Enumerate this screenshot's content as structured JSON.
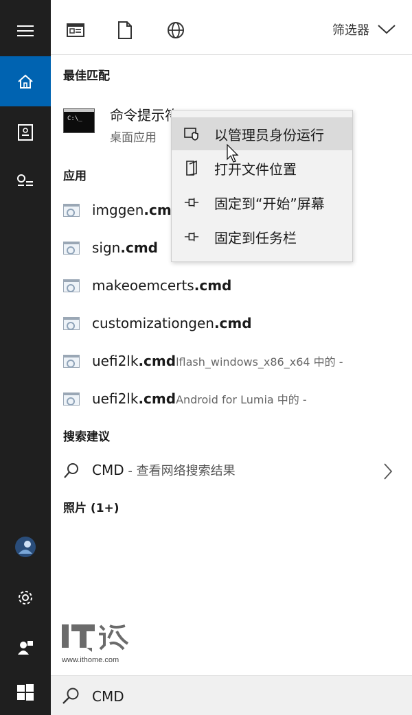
{
  "rail": {
    "items": [
      "hamburger-menu",
      "home",
      "documents",
      "settings-list",
      "user-avatar",
      "settings-gear",
      "feedback-user",
      "windows-start"
    ]
  },
  "toolbar": {
    "icons": [
      "apps-icon",
      "document-icon",
      "globe-icon"
    ],
    "filter_label": "筛选器"
  },
  "sections": {
    "best_match": "最佳匹配",
    "apps": "应用",
    "suggestions": "搜索建议",
    "photos": "照片 (1+)"
  },
  "best_match": {
    "title": "命令提示符",
    "subtitle": "桌面应用",
    "icon_text": "C:\\_"
  },
  "apps": [
    {
      "prefix": "imggen",
      "bold": ".cmd",
      "loc": ""
    },
    {
      "prefix": "sign",
      "bold": ".cmd",
      "loc": ""
    },
    {
      "prefix": "makeoemcerts",
      "bold": ".cmd",
      "loc": ""
    },
    {
      "prefix": "customizationgen",
      "bold": ".cmd",
      "loc": ""
    },
    {
      "prefix": "uefi2lk",
      "bold": ".cmd",
      "loc": "lflash_windows_x86_x64 中的 -"
    },
    {
      "prefix": "uefi2lk",
      "bold": ".cmd",
      "loc": "Android for Lumia 中的 -"
    }
  ],
  "suggestion": {
    "query": "CMD",
    "hint": " - 查看网络搜索结果"
  },
  "context_menu": [
    {
      "label": "以管理员身份运行",
      "icon": "shield-admin-icon"
    },
    {
      "label": "打开文件位置",
      "icon": "folder-open-icon"
    },
    {
      "label": "固定到“开始”屏幕",
      "icon": "pin-icon"
    },
    {
      "label": "固定到任务栏",
      "icon": "pin-icon"
    }
  ],
  "watermark": {
    "logo": "IT之家",
    "url": "www.ithome.com"
  },
  "search": {
    "value": "CMD"
  },
  "colors": {
    "rail_bg": "#1f1f1f",
    "accent": "#0063b1",
    "menu_bg": "#f2f2f2",
    "menu_hover": "#dadada"
  }
}
